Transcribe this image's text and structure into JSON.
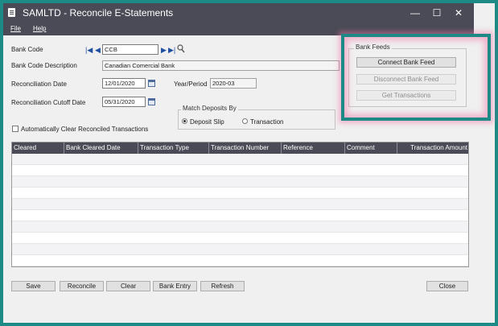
{
  "window": {
    "title": "SAMLTD - Reconcile E-Statements",
    "minimize": "—",
    "maximize": "☐",
    "close": "✕"
  },
  "menu": [
    "File",
    "Help"
  ],
  "form": {
    "bank_code_label": "Bank Code",
    "bank_code_value": "CCB",
    "bank_desc_label": "Bank Code Description",
    "bank_desc_value": "Canadian Comercial Bank",
    "recon_date_label": "Reconciliation Date",
    "recon_date_value": "12/01/2020",
    "year_period_label": "Year/Period",
    "year_period_value": "2020-03",
    "cutoff_label": "Reconciliation Cutoff Date",
    "cutoff_value": "05/31/2020",
    "auto_clear_label": "Automatically Clear Reconciled Transactions",
    "auto_clear_checked": false
  },
  "match_deposits": {
    "title": "Match Deposits By",
    "options": [
      "Deposit Slip",
      "Transaction"
    ],
    "selected": "Deposit Slip"
  },
  "bank_feeds": {
    "title": "Bank Feeds",
    "connect": "Connect Bank Feed",
    "disconnect": "Disconnect Bank Feed",
    "get_transactions": "Get Transactions"
  },
  "grid": {
    "columns": [
      "Cleared",
      "Bank Cleared Date",
      "Transaction Type",
      "Transaction Number",
      "Reference",
      "Comment",
      "Transaction  Amount"
    ]
  },
  "buttons": {
    "save": "Save",
    "reconcile": "Reconcile",
    "clear": "Clear",
    "bank_entry": "Bank Entry",
    "refresh": "Refresh",
    "close": "Close"
  },
  "icons": {
    "first": "first-record-icon",
    "prev": "previous-record-icon",
    "next": "next-record-icon",
    "last": "last-record-icon",
    "finder": "finder-search-icon",
    "calendar": "calendar-icon"
  },
  "colors": {
    "titlebar": "#4a4b56",
    "frame": "#1d8a86",
    "highlight": "#f078aa"
  }
}
